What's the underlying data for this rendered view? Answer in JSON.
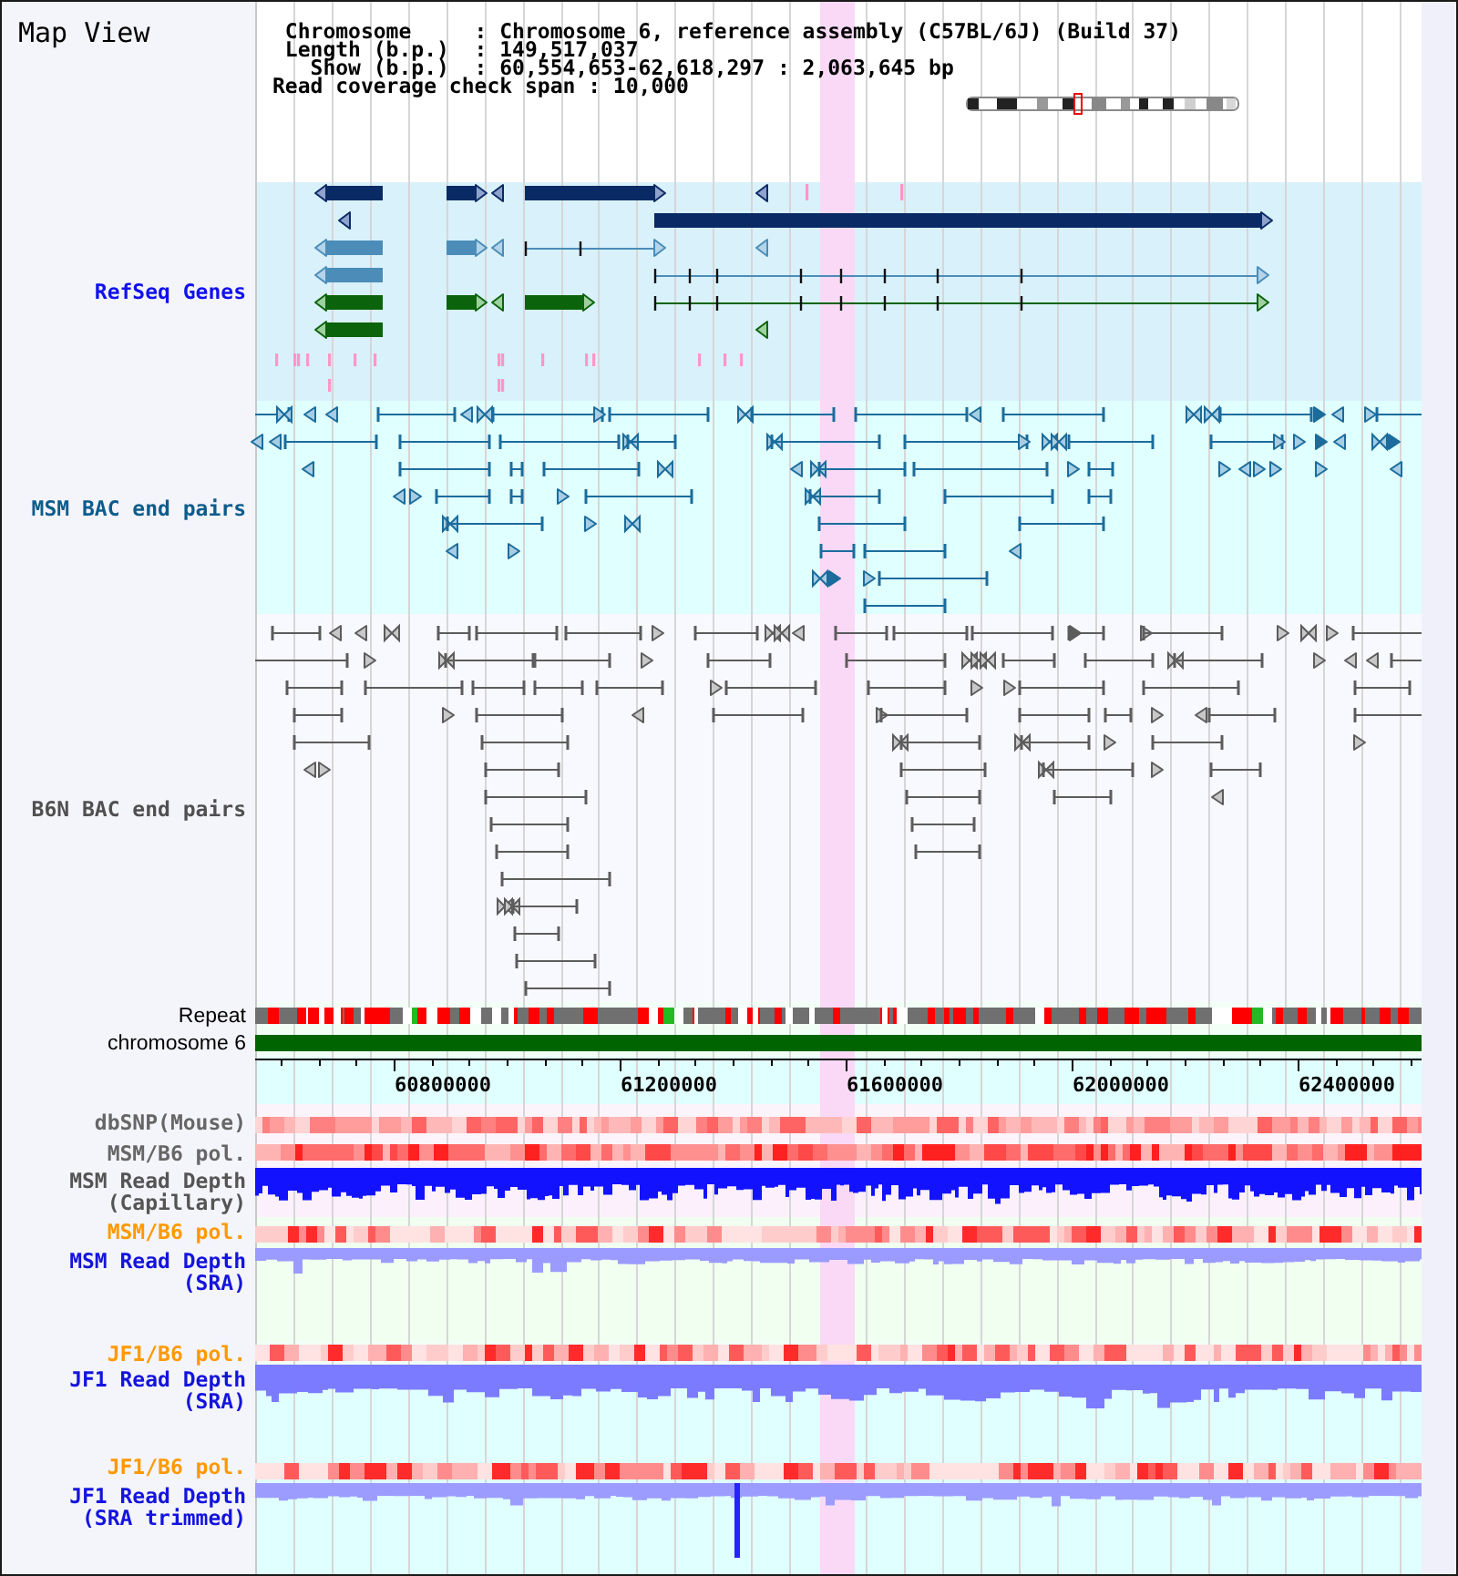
{
  "title": "Map View",
  "info_lines": [
    "Chromosome     : Chromosome 6, reference assembly (C57BL/6J) (Build 37)",
    "Length (b.p.)  : 149,517,037",
    "Show (b.p.)  : 60,554,653-62,618,297 : 2,063,645 bp",
    "Read coverage check span : 10,000"
  ],
  "tracks": [
    {
      "kind": "genes",
      "label": "RefSeq Genes",
      "color": "#1010ee"
    },
    {
      "kind": "pairs",
      "label": "MSM BAC end pairs",
      "color": "#0c5c8c"
    },
    {
      "kind": "pairs",
      "label": "B6N BAC end pairs",
      "color": "#505050"
    },
    {
      "kind": "repeat",
      "label": "Repeat",
      "color": "#000000"
    },
    {
      "kind": "chromosome",
      "label": "chromosome 6",
      "color": "#000000"
    },
    {
      "kind": "axis",
      "ticks": [
        "60800000",
        "61200000",
        "61600000",
        "62000000",
        "62400000"
      ]
    },
    {
      "kind": "heatmap",
      "label": "dbSNP(Mouse)",
      "color": "#666666"
    },
    {
      "kind": "heatmap",
      "label": "MSM/B6 pol.",
      "color": "#666666"
    },
    {
      "kind": "depth",
      "label": "MSM Read Depth (Capillary)",
      "color": "#555555"
    },
    {
      "kind": "heatmap",
      "label": "MSM/B6 pol.",
      "color": "#ff9900"
    },
    {
      "kind": "depth",
      "label": "MSM Read Depth (SRA)",
      "color": "#1414dd"
    },
    {
      "kind": "heatmap",
      "label": "JF1/B6 pol.",
      "color": "#ff9900"
    },
    {
      "kind": "depth",
      "label": "JF1 Read Depth (SRA)",
      "color": "#1414dd"
    },
    {
      "kind": "heatmap",
      "label": "JF1/B6 pol.",
      "color": "#ff9900"
    },
    {
      "kind": "depth",
      "label": "JF1 Read Depth (SRA trimmed)",
      "color": "#1414dd"
    }
  ]
}
